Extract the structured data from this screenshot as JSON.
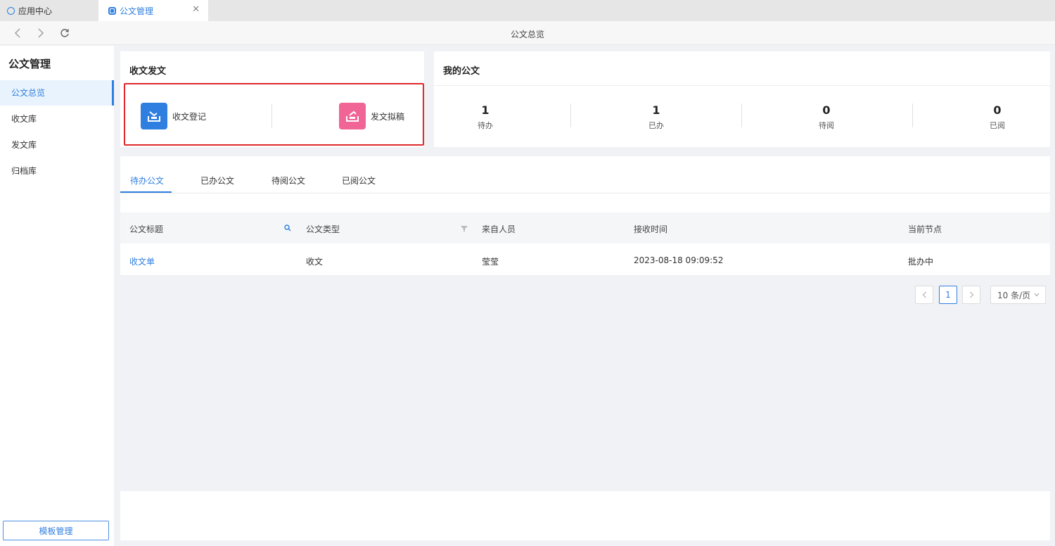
{
  "tabs": [
    {
      "label": "应用中心"
    },
    {
      "label": "公文管理"
    }
  ],
  "toolbar": {
    "page_title": "公文总览"
  },
  "sidebar": {
    "title": "公文管理",
    "items": [
      {
        "label": "公文总览"
      },
      {
        "label": "收文库"
      },
      {
        "label": "发文库"
      },
      {
        "label": "归档库"
      }
    ],
    "template_button": "模板管理"
  },
  "send_receive": {
    "title": "收文发文",
    "receive_label": "收文登记",
    "draft_label": "发文拟稿"
  },
  "my_docs": {
    "title": "我的公文",
    "stats": [
      {
        "value": "1",
        "label": "待办"
      },
      {
        "value": "1",
        "label": "已办"
      },
      {
        "value": "0",
        "label": "待阅"
      },
      {
        "value": "0",
        "label": "已阅"
      }
    ]
  },
  "doc_tabs": [
    {
      "label": "待办公文"
    },
    {
      "label": "已办公文"
    },
    {
      "label": "待阅公文"
    },
    {
      "label": "已阅公文"
    }
  ],
  "table": {
    "columns": [
      "公文标题",
      "公文类型",
      "来自人员",
      "接收时间",
      "当前节点"
    ],
    "rows": [
      {
        "title": "收文单",
        "type": "收文",
        "from": "莹莹",
        "received": "2023-08-18 09:09:52",
        "node": "批办中"
      }
    ]
  },
  "pagination": {
    "current": "1",
    "page_size": "10 条/页"
  },
  "colors": {
    "accent": "#2f7fe0",
    "highlight_border": "#e0282c",
    "receive_icon_bg": "#2f7fe0",
    "draft_icon_bg": "#f06595"
  }
}
